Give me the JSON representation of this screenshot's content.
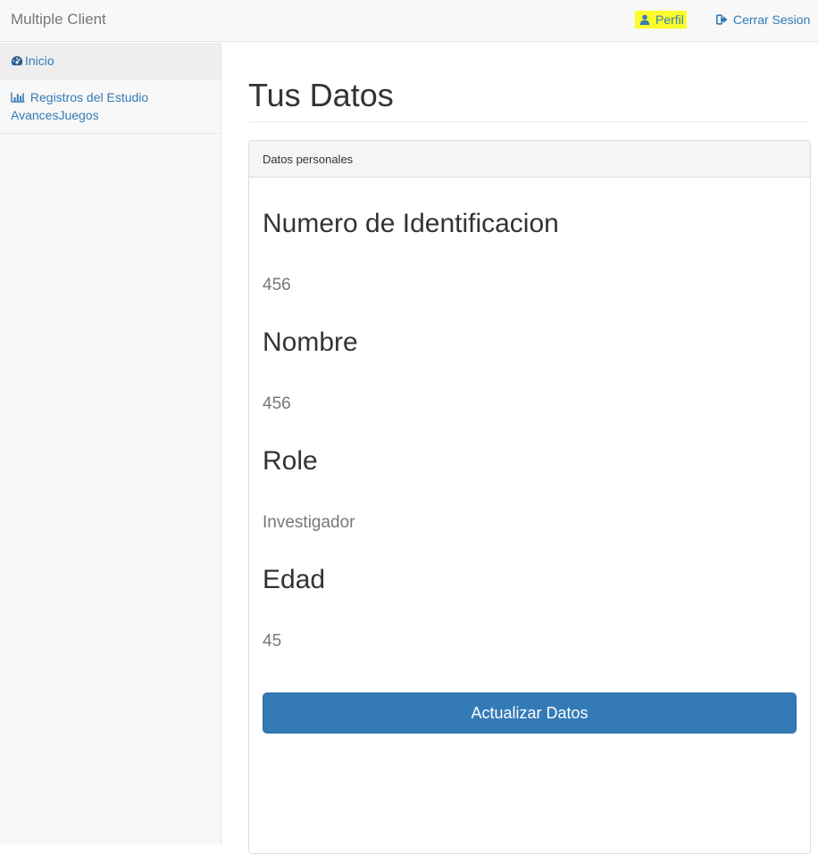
{
  "app": {
    "brand": "Multiple Client"
  },
  "navbar": {
    "profile_label": "Perfil",
    "profile_icon": "user-icon",
    "profile_highlight_color": "#fbfb2c",
    "logout_label": "Cerrar Sesion",
    "logout_icon": "sign-out-icon"
  },
  "sidebar": {
    "items": [
      {
        "label": "Inicio",
        "icon": "dashboard-icon"
      },
      {
        "label_line1": "Registros del Estudio",
        "label_line2": "AvancesJuegos",
        "icon": "bar-chart-icon"
      }
    ]
  },
  "main": {
    "title": "Tus Datos",
    "panel_heading": "Datos personales",
    "fields": [
      {
        "label": "Numero de Identificacion",
        "value": "456"
      },
      {
        "label": "Nombre",
        "value": "456"
      },
      {
        "label": "Role",
        "value": "Investigador"
      },
      {
        "label": "Edad",
        "value": "45"
      }
    ],
    "update_button": "Actualizar Datos"
  },
  "colors": {
    "link": "#337ab7",
    "navbar_bg": "#f8f8f8",
    "button_bg": "#337ab7"
  }
}
